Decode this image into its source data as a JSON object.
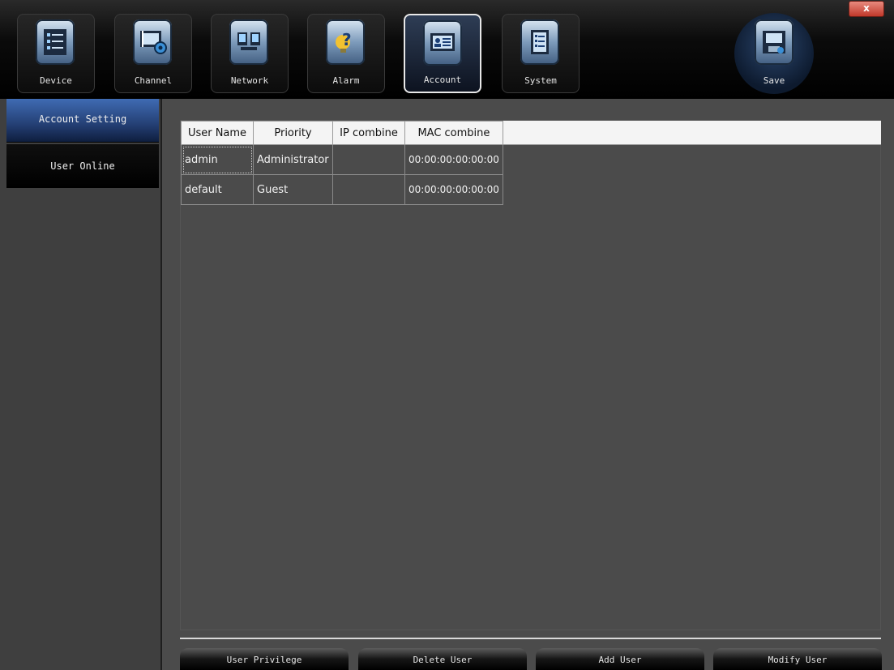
{
  "toolbar": {
    "tabs": [
      {
        "label": "Device",
        "icon": "device-icon"
      },
      {
        "label": "Channel",
        "icon": "channel-icon"
      },
      {
        "label": "Network",
        "icon": "network-icon"
      },
      {
        "label": "Alarm",
        "icon": "alarm-icon"
      },
      {
        "label": "Account",
        "icon": "account-icon",
        "active": true
      },
      {
        "label": "System",
        "icon": "system-icon"
      }
    ],
    "save_label": "Save",
    "close_label": "x"
  },
  "sidebar": {
    "items": [
      {
        "label": "Account Setting",
        "active": true
      },
      {
        "label": "User Online",
        "active": false
      }
    ]
  },
  "table": {
    "columns": [
      "User Name",
      "Priority",
      "IP combine",
      "MAC combine"
    ],
    "rows": [
      [
        "admin",
        "Administrator",
        "",
        "00:00:00:00:00:00"
      ],
      [
        "default",
        "Guest",
        "",
        "00:00:00:00:00:00"
      ]
    ]
  },
  "actions": {
    "user_privilege": "User Privilege",
    "delete_user": "Delete User",
    "add_user": "Add User",
    "modify_user": "Modify User"
  },
  "colors": {
    "accent": "#2f5aa3",
    "close": "#c0392b"
  }
}
